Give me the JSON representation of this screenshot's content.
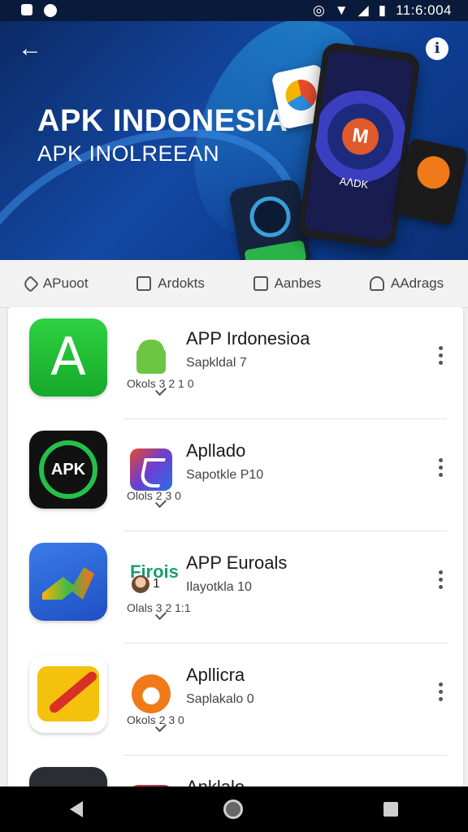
{
  "status_bar": {
    "time": "11:6:004"
  },
  "hero": {
    "title": "APK INDONESIA",
    "subtitle": "APK  INOLREEAN",
    "phone_brand": "AᐱDK"
  },
  "tabs": [
    {
      "label": "APuoot",
      "icon": "tag-icon"
    },
    {
      "label": "Ardokts",
      "icon": "edit-icon"
    },
    {
      "label": "Aanbes",
      "icon": "square-icon"
    },
    {
      "label": "AAdrags",
      "icon": "people-icon"
    }
  ],
  "apps": [
    {
      "name": "APP Irdonesioa",
      "subtitle": "Sapkldal 7",
      "meta": "Okols 3 2 1 0"
    },
    {
      "name": "Apllado",
      "subtitle": "Sapotkle P10",
      "meta": "Olols 2 3 0"
    },
    {
      "name": "APP Euroals",
      "small_icon_text": "Firois",
      "avatar_count": "1",
      "subtitle": "Ilayotkla 10",
      "meta": "Olals 3 2 1:1"
    },
    {
      "name": "Apllicra",
      "subtitle": "Saplakalo 0",
      "meta": "Okols 2 3 0"
    },
    {
      "name": "Anklalo",
      "subtitle": "",
      "meta": ""
    }
  ]
}
